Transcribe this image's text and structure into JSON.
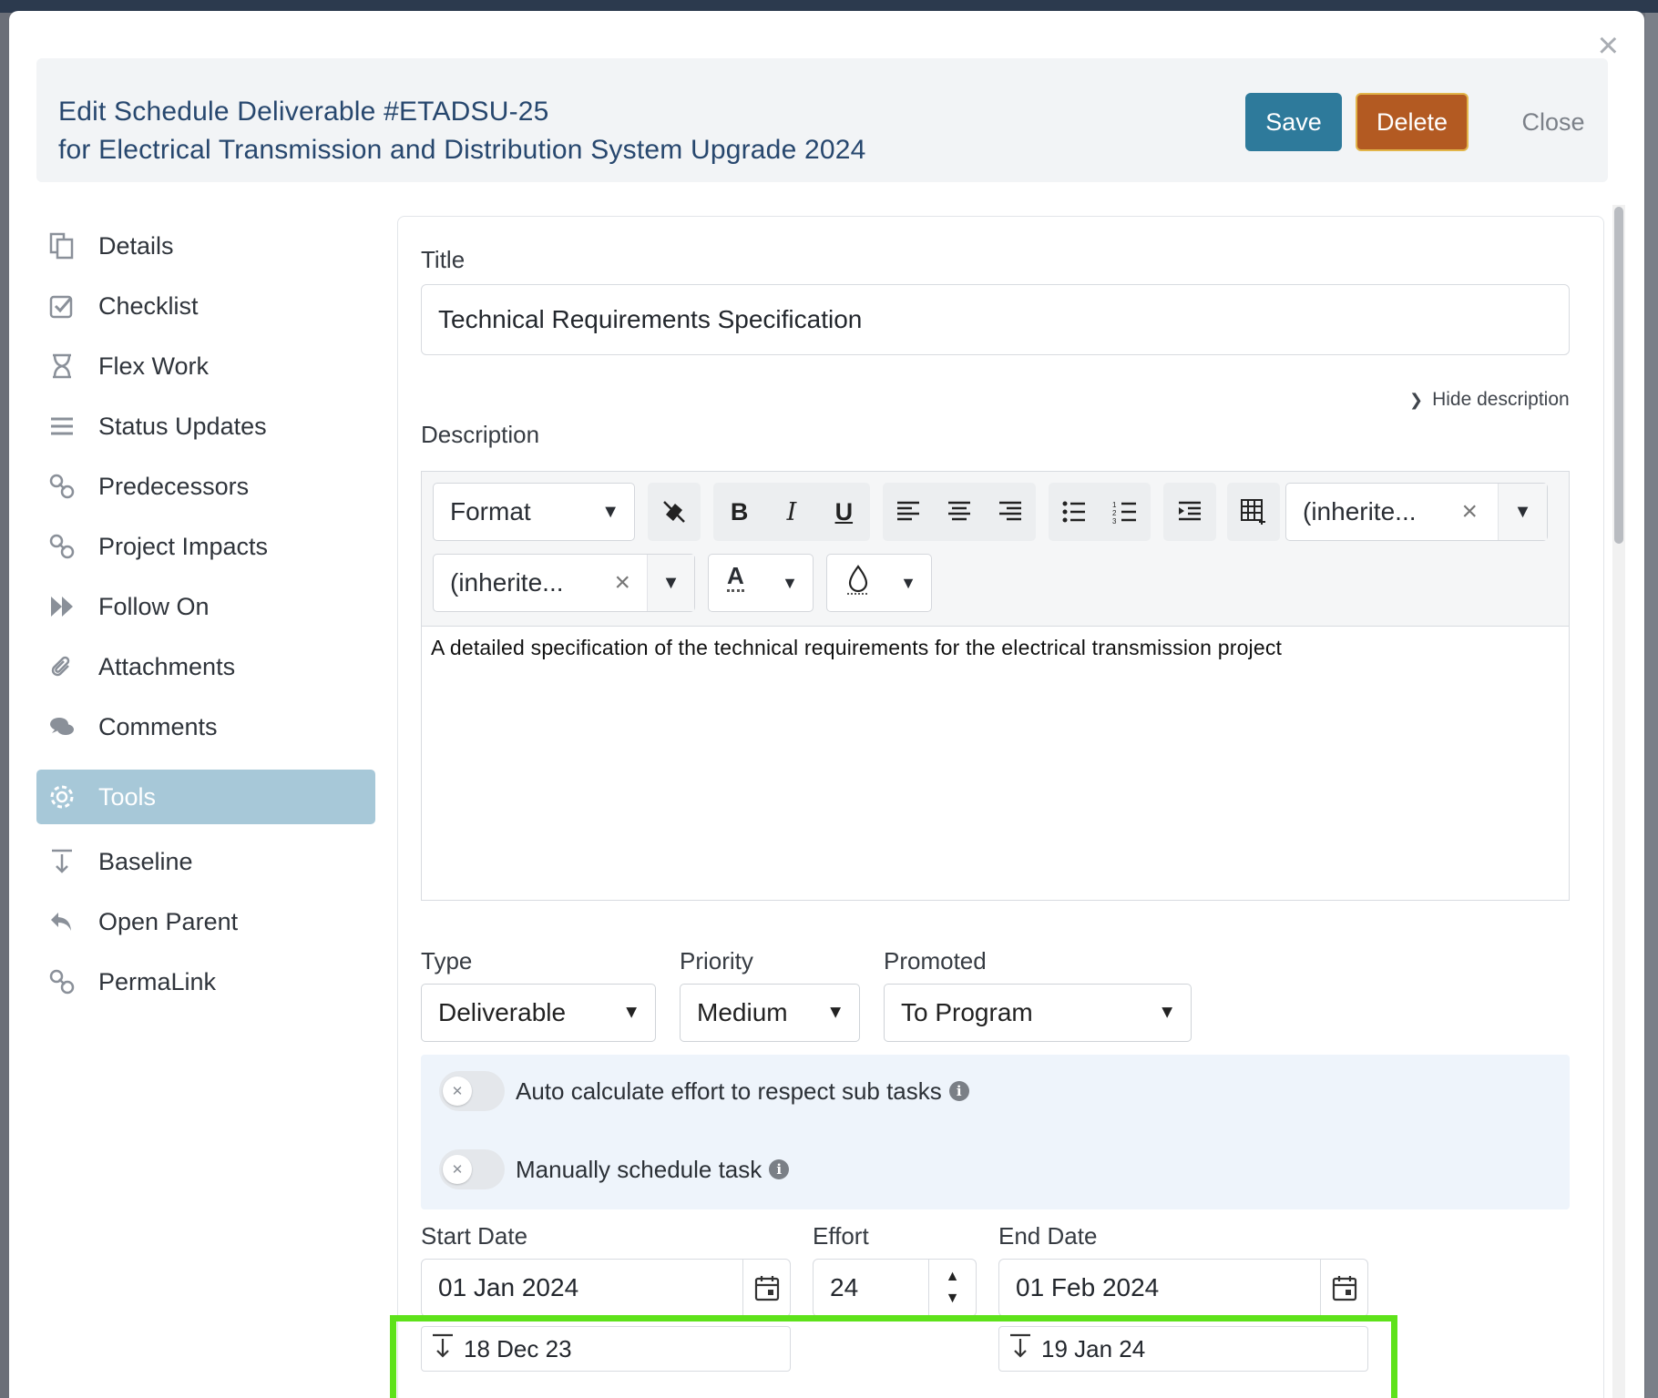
{
  "modal": {
    "title_line1": "Edit Schedule Deliverable #ETADSU-25",
    "title_line2": "for Electrical Transmission and Distribution System Upgrade 2024",
    "save_label": "Save",
    "delete_label": "Delete",
    "close_label": "Close"
  },
  "sidebar": {
    "items": [
      {
        "label": "Details",
        "icon": "document-icon"
      },
      {
        "label": "Checklist",
        "icon": "checkbox-icon"
      },
      {
        "label": "Flex Work",
        "icon": "hourglass-icon"
      },
      {
        "label": "Status Updates",
        "icon": "list-icon"
      },
      {
        "label": "Predecessors",
        "icon": "link-icon"
      },
      {
        "label": "Project Impacts",
        "icon": "link-icon"
      },
      {
        "label": "Follow On",
        "icon": "fast-forward-icon"
      },
      {
        "label": "Attachments",
        "icon": "paperclip-icon"
      },
      {
        "label": "Comments",
        "icon": "comments-icon"
      },
      {
        "label": "Tools",
        "icon": "gear-icon",
        "active": true
      },
      {
        "label": "Baseline",
        "icon": "baseline-icon"
      },
      {
        "label": "Open Parent",
        "icon": "reply-icon"
      },
      {
        "label": "PermaLink",
        "icon": "link-icon"
      }
    ]
  },
  "form": {
    "title_label": "Title",
    "title_value": "Technical Requirements Specification",
    "hide_description": "Hide description",
    "description_label": "Description",
    "toolbar": {
      "format_label": "Format",
      "font_family_value": "(inherite...",
      "font_size_value": "(inherite..."
    },
    "description_value": "A detailed specification of the technical requirements for the electrical transmission project",
    "type_label": "Type",
    "type_value": "Deliverable",
    "priority_label": "Priority",
    "priority_value": "Medium",
    "promoted_label": "Promoted",
    "promoted_value": "To Program",
    "auto_calc_label": "Auto calculate effort to respect sub tasks",
    "manual_schedule_label": "Manually schedule task",
    "start_date_label": "Start Date",
    "start_date_value": "01 Jan 2024",
    "effort_label": "Effort",
    "effort_value": "24",
    "end_date_label": "End Date",
    "end_date_value": "01 Feb 2024",
    "baseline_start": "18 Dec 23",
    "baseline_end": "19 Jan 24"
  },
  "colors": {
    "save": "#2e7a9b",
    "delete": "#b35a22",
    "active_nav": "#a7c8d8",
    "highlight": "#5ee21a",
    "title_text": "#27476e"
  }
}
